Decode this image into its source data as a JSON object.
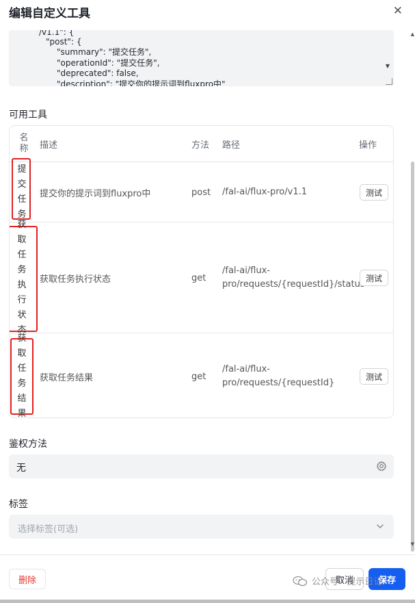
{
  "dialog": {
    "title": "编辑自定义工具",
    "close_icon": "close-icon"
  },
  "schema_code": {
    "lines": [
      "/v1.1\": {",
      "\"post\": {",
      "\"summary\": \"提交任务\",",
      "\"operationId\": \"提交任务\",",
      "\"deprecated\": false,",
      "\"description\": \"提交你的提示词到fluxpro中\""
    ]
  },
  "tools_section": {
    "label": "可用工具",
    "columns": {
      "name": "名称",
      "description": "描述",
      "method": "方法",
      "path": "路径",
      "action": "操作"
    },
    "rows": [
      {
        "name": "提交任务",
        "description": "提交你的提示词到fluxpro中",
        "method": "post",
        "path_line1": "/fal-ai/flux-pro/v1.1",
        "path_line2": "",
        "action_label": "测试"
      },
      {
        "name": "获取任务执行状态",
        "description": "获取任务执行状态",
        "method": "get",
        "path_line1": "/fal-ai/flux-",
        "path_line2": "pro/requests/{requestId}/status",
        "action_label": "测试"
      },
      {
        "name": "获取任务结果",
        "description": "获取任务结果",
        "method": "get",
        "path_line1": "/fal-ai/flux-",
        "path_line2": "pro/requests/{requestId}",
        "action_label": "测试"
      }
    ]
  },
  "auth_section": {
    "label": "鉴权方法",
    "value": "无",
    "icon": "gear-icon"
  },
  "tags_section": {
    "label": "标签",
    "placeholder": "选择标签(可选)",
    "icon": "chevron-down-icon"
  },
  "footer": {
    "delete_label": "删除",
    "cancel_label": "取消",
    "save_label": "保存"
  },
  "watermark": {
    "text": "公众号 · 提示日记"
  },
  "colors": {
    "accent": "#155eef",
    "danger": "#e53935",
    "highlight_box": "#e02020"
  }
}
